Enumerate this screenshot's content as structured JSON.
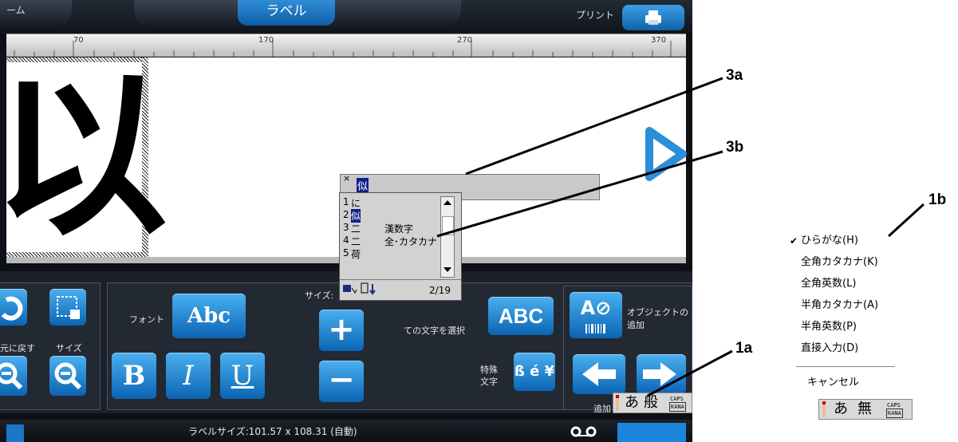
{
  "top_bar": {
    "left_fragment": "ーム",
    "center_tab": "ラベル",
    "right_label": "プリント"
  },
  "ruler": {
    "numbers": [
      "70",
      "170",
      "270",
      "370"
    ]
  },
  "canvas": {
    "glyph": "以"
  },
  "ime_composition": {
    "close_mark": "×",
    "text": "似"
  },
  "candidates": {
    "items": [
      {
        "num": "1",
        "text": "に",
        "note": ""
      },
      {
        "num": "2",
        "text": "似",
        "note": ""
      },
      {
        "num": "3",
        "text": "二",
        "note": "漢数字"
      },
      {
        "num": "4",
        "text": "二",
        "note": "全･カタカナ"
      },
      {
        "num": "5",
        "text": "荷",
        "note": ""
      }
    ],
    "selected_index": 1,
    "page": "2/19"
  },
  "panel": {
    "undo_label": "元に戻す",
    "size_label": "サイズ",
    "font_label": "フォント",
    "font_button": "Abc",
    "size_prefix": "サイズ:",
    "bold": "B",
    "italic": "I",
    "underline": "U",
    "plus": "+",
    "minus": "−",
    "select_all": "ての文字を選択",
    "abc_button": "ABC",
    "special_label": "特殊\n文字",
    "special_button": "ß é ¥",
    "object_button": "A⊘",
    "object_label": "オブジェクトの追加",
    "add_label": "追加"
  },
  "status": {
    "label_size": "ラベルサイズ:101.57 x 108.31 (自動)"
  },
  "ime_bar_small": {
    "mode1": "あ",
    "mode2": "般",
    "caps": "CAPS",
    "kana": "KANA"
  },
  "ime_bar_right": {
    "mode1": "あ",
    "mode2": "無",
    "caps": "CAPS",
    "kana": "KANA"
  },
  "ime_menu": {
    "items": [
      {
        "text": "ひらがな(H)",
        "checked": true
      },
      {
        "text": "全角カタカナ(K)",
        "checked": false
      },
      {
        "text": "全角英数(L)",
        "checked": false
      },
      {
        "text": "半角カタカナ(A)",
        "checked": false
      },
      {
        "text": "半角英数(P)",
        "checked": false
      },
      {
        "text": "直接入力(D)",
        "checked": false
      }
    ],
    "cancel": "キャンセル",
    "check_mark": "✔"
  },
  "callouts": {
    "c3a": "3a",
    "c3b": "3b",
    "c1a": "1a",
    "c1b": "1b"
  }
}
